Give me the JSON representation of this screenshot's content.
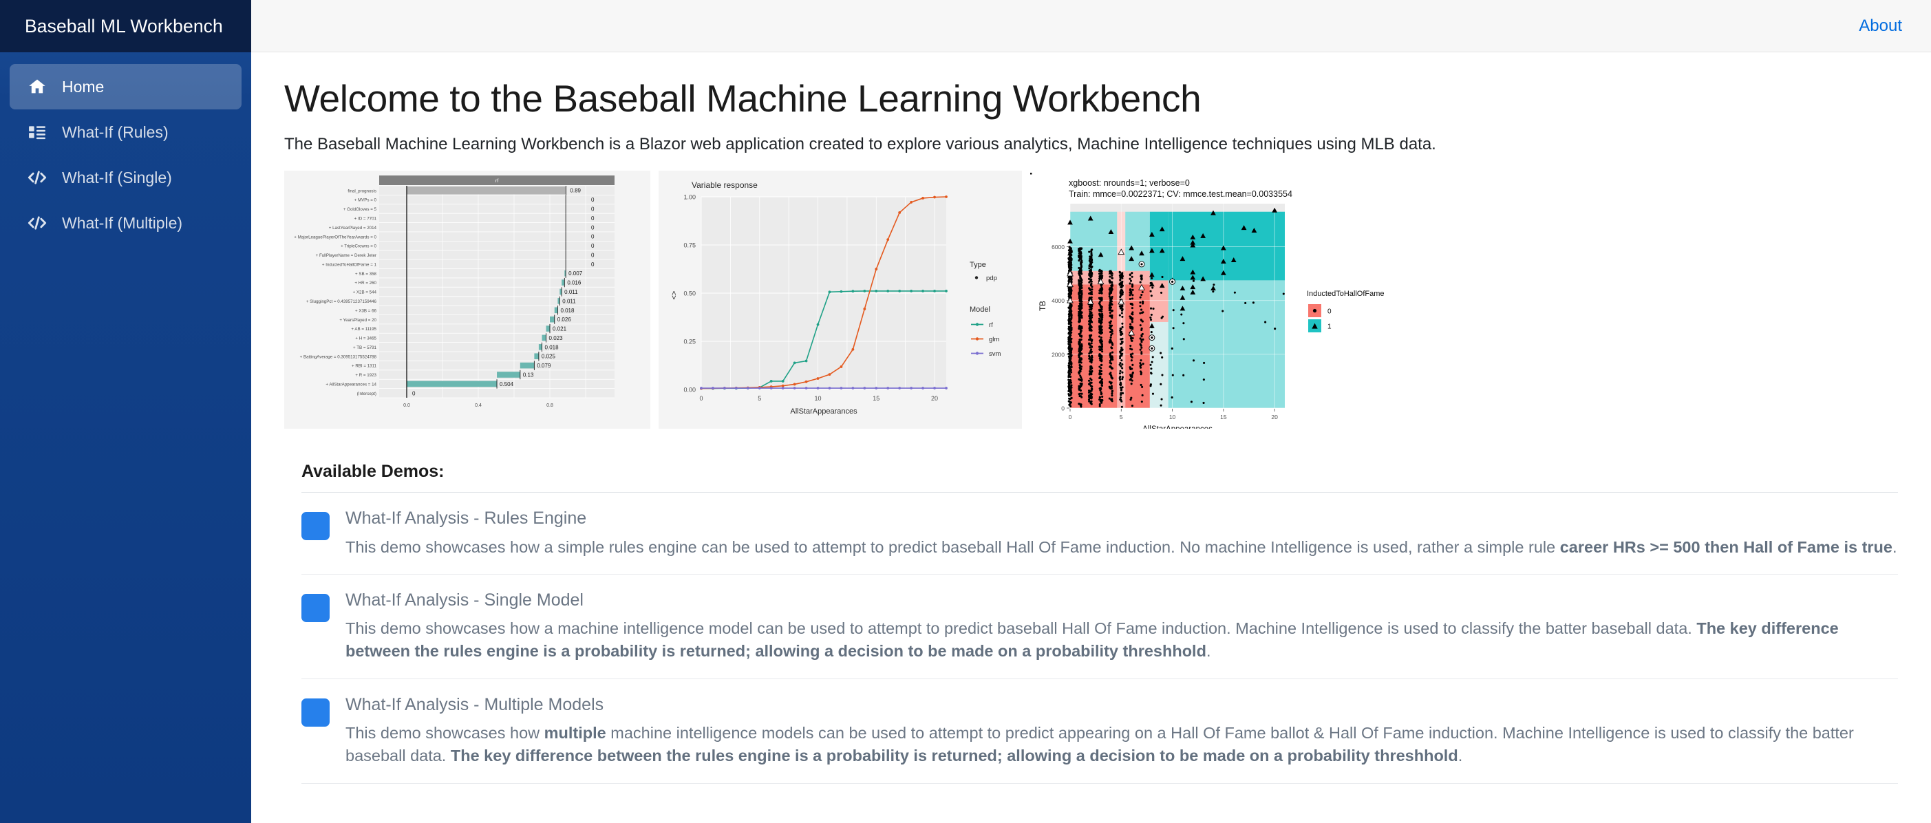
{
  "brand": {
    "title": "Baseball ML Workbench"
  },
  "sidebar": {
    "items": [
      {
        "label": "Home",
        "icon": "home-icon",
        "active": true
      },
      {
        "label": "What-If (Rules)",
        "icon": "list-icon",
        "active": false
      },
      {
        "label": "What-If (Single)",
        "icon": "code-icon",
        "active": false
      },
      {
        "label": "What-If (Multiple)",
        "icon": "code-icon",
        "active": false
      }
    ]
  },
  "topbar": {
    "about_label": "About",
    "link_color": "#006bdf"
  },
  "page": {
    "title": "Welcome to the Baseball Machine Learning Workbench",
    "intro": "The Baseball Machine Learning Workbench is a Blazor web application created to explore various analytics, Machine Intelligence techniques using MLB data.",
    "demos_heading": "Available Demos:"
  },
  "demos": [
    {
      "badge_color": "#2680eb",
      "title": "What-If Analysis - Rules Engine",
      "desc_parts": [
        {
          "text": "This demo showcases how a simple rules engine can be used to attempt to predict baseball Hall Of Fame induction. No machine Intelligence is used, rather a simple rule ",
          "bold": false
        },
        {
          "text": "career HRs >= 500 then Hall of Fame is true",
          "bold": true
        },
        {
          "text": ".",
          "bold": false
        }
      ]
    },
    {
      "badge_color": "#2680eb",
      "title": "What-If Analysis - Single Model",
      "desc_parts": [
        {
          "text": "This demo showcases how a machine intelligence model can be used to attempt to predict baseball Hall Of Fame induction. Machine Intelligence is used to classify the batter baseball data. ",
          "bold": false
        },
        {
          "text": "The key difference between the rules engine is a probability is returned; allowing a decision to be made on a probability threshhold",
          "bold": true
        },
        {
          "text": ".",
          "bold": false
        }
      ]
    },
    {
      "badge_color": "#2680eb",
      "title": "What-If Analysis - Multiple Models",
      "desc_parts": [
        {
          "text": "This demo showcases how ",
          "bold": false
        },
        {
          "text": "multiple",
          "bold": true
        },
        {
          "text": " machine intelligence models can be used to attempt to predict appearing on a Hall Of Fame ballot & Hall Of Fame induction. Machine Intelligence is used to classify the batter baseball data. ",
          "bold": false
        },
        {
          "text": "The key difference between the rules engine is a probability is returned; allowing a decision to be made on a probability threshhold",
          "bold": true
        },
        {
          "text": ".",
          "bold": false
        }
      ]
    }
  ],
  "chart_data": [
    {
      "type": "bar",
      "chart_name": "break-down-waterfall-rf",
      "title": "rf",
      "orientation": "horizontal",
      "xlabel": "",
      "ylabel": "",
      "xlim": [
        0,
        1.0
      ],
      "xticks": [
        0.0,
        0.4,
        0.8
      ],
      "xtick_labels": [
        "0.0",
        "0.4",
        "0.8"
      ],
      "grid": true,
      "bar_color": "#6bb7b0",
      "summary_bar_color": "#b3b3b3",
      "categories": [
        "(Intercept)",
        "+ AllStarAppearances = 14",
        "+ R = 1923",
        "+ RBI = 1311",
        "+ BattingAverage = 0.309513175524788",
        "+ TB = 5791",
        "+ H = 3465",
        "+ AB = 11195",
        "+ YearsPlayed = 20",
        "+ X3B = 66",
        "+ SluggingPct = 0.439571237159446",
        "+ X2B = 544",
        "+ HR = 260",
        "+ SB = 358",
        "+ InductedToHallOfFame = 1",
        "+ FullPlayerName = Derek Jeter",
        "+ TripleCrowns = 0",
        "+ MajorLeaguePlayerOfTheYearAwards = 0",
        "+ LastYearPlayed = 2014",
        "+ ID = 7701",
        "+ GoldGloves = 5",
        "+ MVPs = 0",
        "final_prognosis"
      ],
      "values": [
        0,
        0.504,
        0.13,
        0.079,
        0.025,
        0.018,
        0.023,
        0.021,
        0.026,
        0.018,
        0.011,
        0.011,
        0.016,
        0.007,
        0,
        0,
        0,
        0,
        0,
        0,
        0,
        0,
        0.89
      ],
      "value_labels": [
        "0",
        "0.504",
        "0.13",
        "0.079",
        "0.025",
        "0.018",
        "0.023",
        "0.021",
        "0.026",
        "0.018",
        "0.011",
        "0.011",
        "0.016",
        "0.007",
        "0",
        "0",
        "0",
        "0",
        "0",
        "0",
        "0",
        "0",
        "0.89"
      ]
    },
    {
      "type": "line",
      "chart_name": "variable-response-pdp",
      "title": "Variable response",
      "xlabel": "AllStarAppearances",
      "ylabel": "<>",
      "xlim": [
        0,
        21
      ],
      "ylim": [
        0,
        1.0
      ],
      "xticks": [
        0,
        5,
        10,
        15,
        20
      ],
      "yticks": [
        0.0,
        0.25,
        0.5,
        0.75,
        1.0
      ],
      "ytick_labels": [
        "0.00",
        "0.25",
        "0.50",
        "0.75",
        "1.00"
      ],
      "grid": true,
      "legend_position": "right",
      "legends": [
        {
          "title": "Type",
          "entries": [
            {
              "label": "pdp",
              "marker": "dot",
              "color": "#222222"
            }
          ]
        },
        {
          "title": "Model",
          "entries": [
            {
              "label": "rf",
              "color": "#1fa187"
            },
            {
              "label": "glm",
              "color": "#e4591e"
            },
            {
              "label": "svm",
              "color": "#7b6fd0"
            }
          ]
        }
      ],
      "x": [
        0,
        1,
        2,
        3,
        4,
        5,
        6,
        7,
        8,
        9,
        10,
        11,
        12,
        13,
        14,
        15,
        16,
        17,
        18,
        19,
        20,
        21
      ],
      "series": [
        {
          "name": "rf",
          "color": "#1fa187",
          "values": [
            0.005,
            0.005,
            0.006,
            0.006,
            0.007,
            0.01,
            0.043,
            0.043,
            0.138,
            0.148,
            0.337,
            0.506,
            0.508,
            0.51,
            0.511,
            0.511,
            0.511,
            0.511,
            0.511,
            0.511,
            0.511,
            0.511
          ]
        },
        {
          "name": "glm",
          "color": "#e4591e",
          "values": [
            0.005,
            0.006,
            0.007,
            0.008,
            0.009,
            0.011,
            0.014,
            0.019,
            0.027,
            0.04,
            0.057,
            0.078,
            0.118,
            0.208,
            0.418,
            0.625,
            0.778,
            0.918,
            0.972,
            0.993,
            0.998,
            1.0
          ]
        },
        {
          "name": "svm",
          "color": "#7b6fd0",
          "values": [
            0.007,
            0.007,
            0.007,
            0.007,
            0.007,
            0.007,
            0.007,
            0.007,
            0.007,
            0.007,
            0.007,
            0.007,
            0.007,
            0.007,
            0.007,
            0.007,
            0.007,
            0.007,
            0.007,
            0.007,
            0.007,
            0.007
          ]
        }
      ]
    },
    {
      "type": "scatter",
      "chart_name": "xgboost-decision-boundary",
      "title": "xgboost: nrounds=1; verbose=0",
      "subtitle": "Train: mmce=0.0022371; CV: mmce.test.mean=0.0033554",
      "xlabel": "AllStarAppearances",
      "ylabel": "TB",
      "xlim": [
        0,
        21
      ],
      "ylim": [
        0,
        7600
      ],
      "xticks": [
        0,
        5,
        10,
        15,
        20
      ],
      "yticks": [
        0,
        2000,
        4000,
        6000
      ],
      "grid": true,
      "legend_title": "InductedToHallOfFame",
      "legend_entries": [
        {
          "label": "0",
          "color": "#f8766d",
          "marker": "circle"
        },
        {
          "label": "1",
          "color": "#1fc3c3",
          "marker": "triangle"
        }
      ]
    }
  ]
}
